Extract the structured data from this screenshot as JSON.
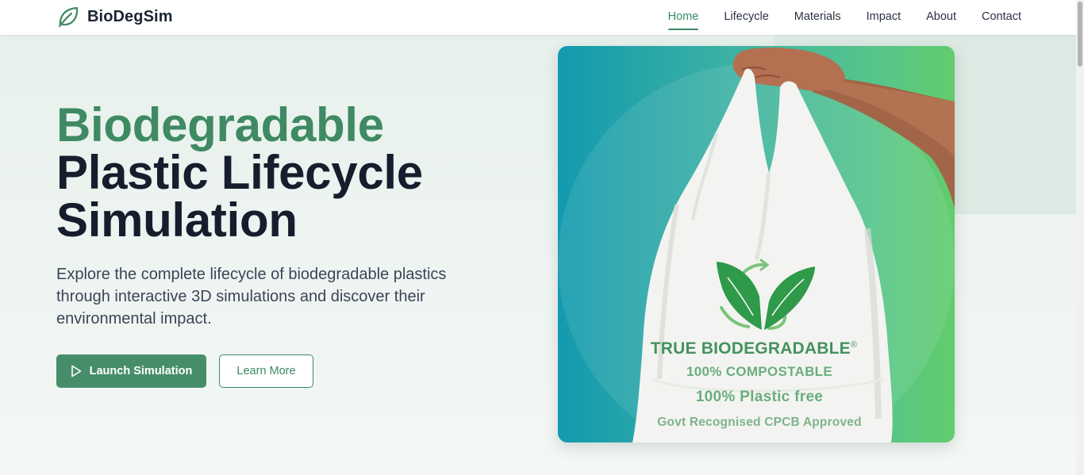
{
  "brand": {
    "name": "BioDegSim",
    "icon": "leaf-icon"
  },
  "nav": {
    "items": [
      {
        "label": "Home",
        "active": true
      },
      {
        "label": "Lifecycle",
        "active": false
      },
      {
        "label": "Materials",
        "active": false
      },
      {
        "label": "Impact",
        "active": false
      },
      {
        "label": "About",
        "active": false
      },
      {
        "label": "Contact",
        "active": false
      }
    ]
  },
  "hero": {
    "title_accent": "Biodegradable",
    "title_line2": "Plastic Lifecycle",
    "title_line3": "Simulation",
    "description": "Explore the complete lifecycle of biodegradable plastics through interactive 3D simulations and discover their environmental impact.",
    "primary_button": {
      "label": "Launch Simulation",
      "icon": "play-icon"
    },
    "secondary_button": {
      "label": "Learn More"
    }
  },
  "hero_image": {
    "line1": "TRUE BIODEGRADABLE",
    "line1_mark": "®",
    "line2": "100% COMPOSTABLE",
    "line3": "100% Plastic free",
    "line4": "Govt Recognised CPCB Approved"
  },
  "colors": {
    "accent": "#3f8a63",
    "button_bg": "#468e6a",
    "heading_dark": "#161d2c",
    "card_gradient_start": "#139aae",
    "card_gradient_end": "#62cc6c"
  }
}
